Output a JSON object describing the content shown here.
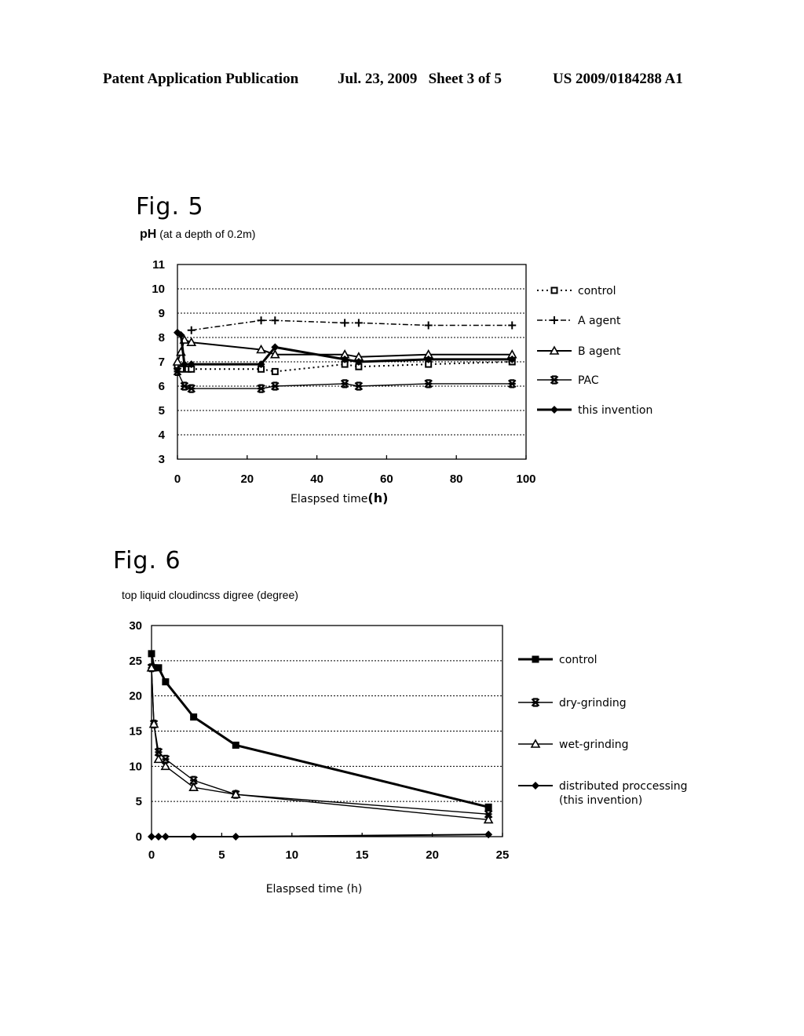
{
  "header": {
    "left": "Patent Application Publication",
    "middle": "Jul. 23, 2009   Sheet 3 of 5",
    "right": "US 2009/0184288 A1"
  },
  "chart_data": [
    {
      "id": "fig5",
      "type": "line",
      "figure_label": "Fig. 5",
      "title": "pH (at a depth of 0.2m)",
      "title_bold": "pH",
      "title_rest": " (at a depth of 0.2m)",
      "xlabel": "Elaspsed time (h)",
      "xlabel_main": "Elaspsed time",
      "xlabel_unit": "(h)",
      "ylabel": "pH",
      "xlim": [
        0,
        100
      ],
      "ylim": [
        3,
        11
      ],
      "xticks": [
        0,
        20,
        40,
        60,
        80,
        100
      ],
      "yticks": [
        3,
        4,
        5,
        6,
        7,
        8,
        9,
        10,
        11
      ],
      "grid": "horizontal-dotted",
      "legend_position": "right",
      "series": [
        {
          "name": "control",
          "marker": "square-open",
          "line": "dotted",
          "x": [
            0,
            1,
            3,
            4,
            24,
            28,
            48,
            52,
            72,
            96
          ],
          "y": [
            6.8,
            6.7,
            6.7,
            6.7,
            6.7,
            6.6,
            6.9,
            6.8,
            6.9,
            7.0
          ]
        },
        {
          "name": "A agent",
          "marker": "plus",
          "line": "dash-dot",
          "x": [
            4,
            24,
            28,
            48,
            52,
            72,
            96
          ],
          "y": [
            8.3,
            8.7,
            8.7,
            8.6,
            8.6,
            8.5,
            8.5
          ]
        },
        {
          "name": "B agent",
          "marker": "triangle-open",
          "line": "solid",
          "x": [
            0,
            1,
            2,
            4,
            24,
            28,
            48,
            52,
            72,
            96
          ],
          "y": [
            7.0,
            7.4,
            7.9,
            7.8,
            7.5,
            7.3,
            7.3,
            7.2,
            7.3,
            7.3
          ]
        },
        {
          "name": "PAC",
          "marker": "asterisk",
          "line": "solid-thin",
          "x": [
            0,
            2,
            4,
            24,
            28,
            48,
            52,
            72,
            96
          ],
          "y": [
            6.6,
            6.0,
            5.9,
            5.9,
            6.0,
            6.1,
            6.0,
            6.1,
            6.1
          ],
          "note": "x=0 start value near 6.7"
        },
        {
          "name": "this invention",
          "marker": "diamond-filled",
          "line": "solid-bold",
          "x": [
            0,
            1,
            2,
            4,
            24,
            28,
            48,
            52,
            72,
            96
          ],
          "y": [
            8.2,
            8.1,
            6.9,
            6.9,
            6.9,
            7.6,
            7.1,
            7.0,
            7.1,
            7.1
          ]
        }
      ]
    },
    {
      "id": "fig6",
      "type": "line",
      "figure_label": "Fig. 6",
      "title": "top liquid cloudincss digree (degree)",
      "xlabel": "Elaspsed time (h)",
      "ylabel": "top liquid cloudiness degree",
      "xlim": [
        0,
        25
      ],
      "ylim": [
        0,
        30
      ],
      "xticks": [
        0,
        5,
        10,
        15,
        20,
        25
      ],
      "yticks": [
        0,
        5,
        10,
        15,
        20,
        25,
        30
      ],
      "grid": "horizontal-dotted",
      "legend_position": "right",
      "series": [
        {
          "name": "control",
          "marker": "square-filled",
          "line": "solid-bold",
          "x": [
            0,
            0.17,
            0.5,
            1,
            3,
            6,
            24
          ],
          "y": [
            26,
            24,
            24,
            22,
            17,
            13,
            4.2
          ]
        },
        {
          "name": "dry-grinding",
          "marker": "asterisk",
          "line": "solid-thin",
          "x": [
            0,
            0.17,
            0.5,
            1,
            3,
            6,
            24
          ],
          "y": [
            24,
            16,
            12,
            11,
            8,
            6,
            3.2
          ]
        },
        {
          "name": "wet-grinding",
          "marker": "triangle-open",
          "line": "solid-thin",
          "x": [
            0,
            0.17,
            0.5,
            1,
            3,
            6,
            24
          ],
          "y": [
            24,
            16,
            11,
            10,
            7,
            6,
            2.4
          ]
        },
        {
          "name": "distributed proccessing\n(this invention)",
          "label_line1": "distributed proccessing",
          "label_line2": "(this invention)",
          "marker": "diamond-filled",
          "line": "solid",
          "x": [
            0,
            0.5,
            1,
            3,
            6,
            24
          ],
          "y": [
            0,
            0,
            0,
            0,
            0,
            0.3
          ]
        }
      ]
    }
  ]
}
